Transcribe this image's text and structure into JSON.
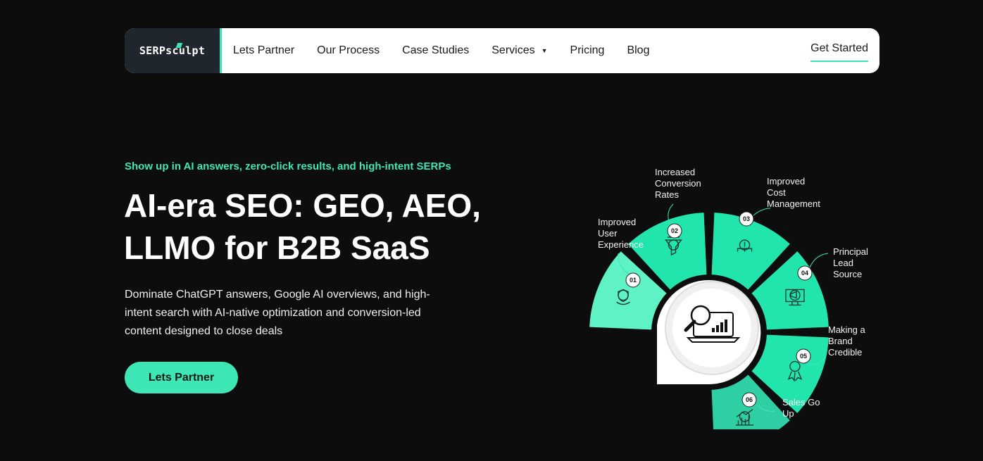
{
  "nav": {
    "logo": "SERPsculpt",
    "links": [
      "Lets Partner",
      "Our Process",
      "Case Studies",
      "Services",
      "Pricing",
      "Blog"
    ],
    "cta": "Get Started"
  },
  "hero": {
    "eyebrow": "Show up in AI answers, zero-click results, and high-intent SERPs",
    "headline_line1": "AI-era SEO: GEO, AEO,",
    "headline_line2": "LLMO for B2B SaaS",
    "subtext": "Dominate ChatGPT answers, Google AI overviews, and high-intent search with AI-native optimization and conversion-led content designed to close deals",
    "cta": "Lets Partner"
  },
  "graphic": {
    "colors": {
      "mint_light": "#5ff2c4",
      "mint": "#22e5ad",
      "mint_dark": "#2fcfa6"
    },
    "steps": [
      {
        "num": "01",
        "label_lines": [
          "Improved",
          "User",
          "Experience"
        ],
        "icon": "hand-shield-icon"
      },
      {
        "num": "02",
        "label_lines": [
          "Increased",
          "Conversion",
          "Rates"
        ],
        "icon": "funnel-icon"
      },
      {
        "num": "03",
        "label_lines": [
          "Improved",
          "Cost",
          "Management"
        ],
        "icon": "cost-tree-icon"
      },
      {
        "num": "04",
        "label_lines": [
          "Principal",
          "Lead",
          "Source"
        ],
        "icon": "megaphone-monitor-icon"
      },
      {
        "num": "05",
        "label_lines": [
          "Making a",
          "Brand",
          "Credible"
        ],
        "icon": "award-badge-icon"
      },
      {
        "num": "06",
        "label_lines": [
          "Sales Go",
          "Up"
        ],
        "icon": "sales-chart-icon"
      }
    ]
  },
  "colors": {
    "accent": "#3ee6b6",
    "background": "#0d0d0d",
    "nav_bg": "#ffffff",
    "logo_bg": "#20262d"
  }
}
